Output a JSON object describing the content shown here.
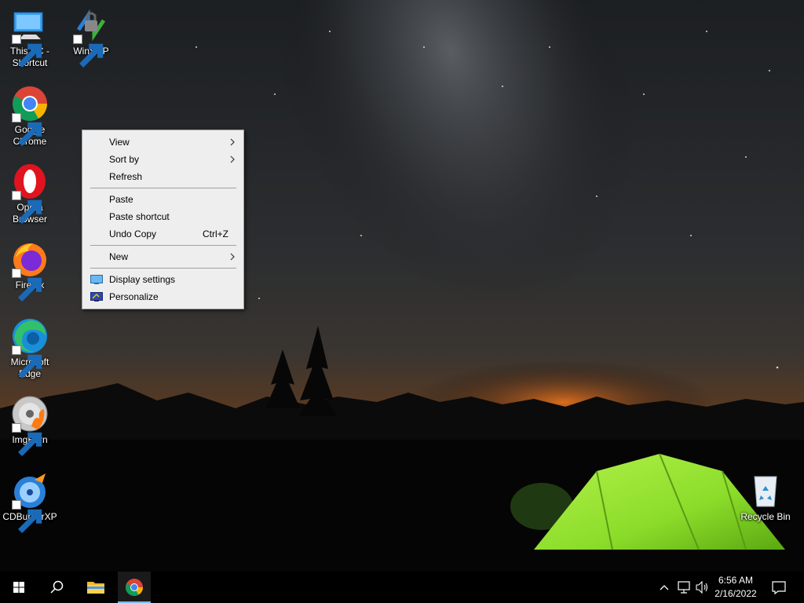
{
  "desktop": {
    "icons": [
      {
        "label": "This PC -\nShortcut",
        "icon": "computer-icon"
      },
      {
        "label": "WinSCP",
        "icon": "winscp-icon"
      },
      {
        "label": "Google\nChrome",
        "icon": "chrome-icon"
      },
      {
        "label": "Opera\nBrowser",
        "icon": "opera-icon"
      },
      {
        "label": "Firefox",
        "icon": "firefox-icon"
      },
      {
        "label": "Microsoft\nEdge",
        "icon": "edge-icon"
      },
      {
        "label": "ImgBurn",
        "icon": "imgburn-icon"
      },
      {
        "label": "CDBurnerXP",
        "icon": "cdburnerxp-icon"
      },
      {
        "label": "Recycle Bin",
        "icon": "recycle-bin-icon"
      }
    ]
  },
  "context_menu": {
    "view": "View",
    "sort_by": "Sort by",
    "refresh": "Refresh",
    "paste": "Paste",
    "paste_shortcut": "Paste shortcut",
    "undo_copy": "Undo Copy",
    "undo_copy_shortcut": "Ctrl+Z",
    "new": "New",
    "display_settings": "Display settings",
    "personalize": "Personalize"
  },
  "taskbar": {
    "start": "windows-start-icon",
    "search": "search-icon",
    "pinned": [
      "file-explorer-icon",
      "chrome-icon"
    ],
    "tray": [
      "chevron-up-icon",
      "network-icon",
      "volume-icon",
      "notification-icon"
    ],
    "time": "6:56 AM",
    "date": "2/16/2022"
  },
  "colors": {
    "menu_bg": "#eeeeee",
    "taskbar_bg": "#000000",
    "active_indicator": "#76b9ed",
    "tent": "#8bdc2a",
    "horizon_glow": "#e0701c"
  }
}
